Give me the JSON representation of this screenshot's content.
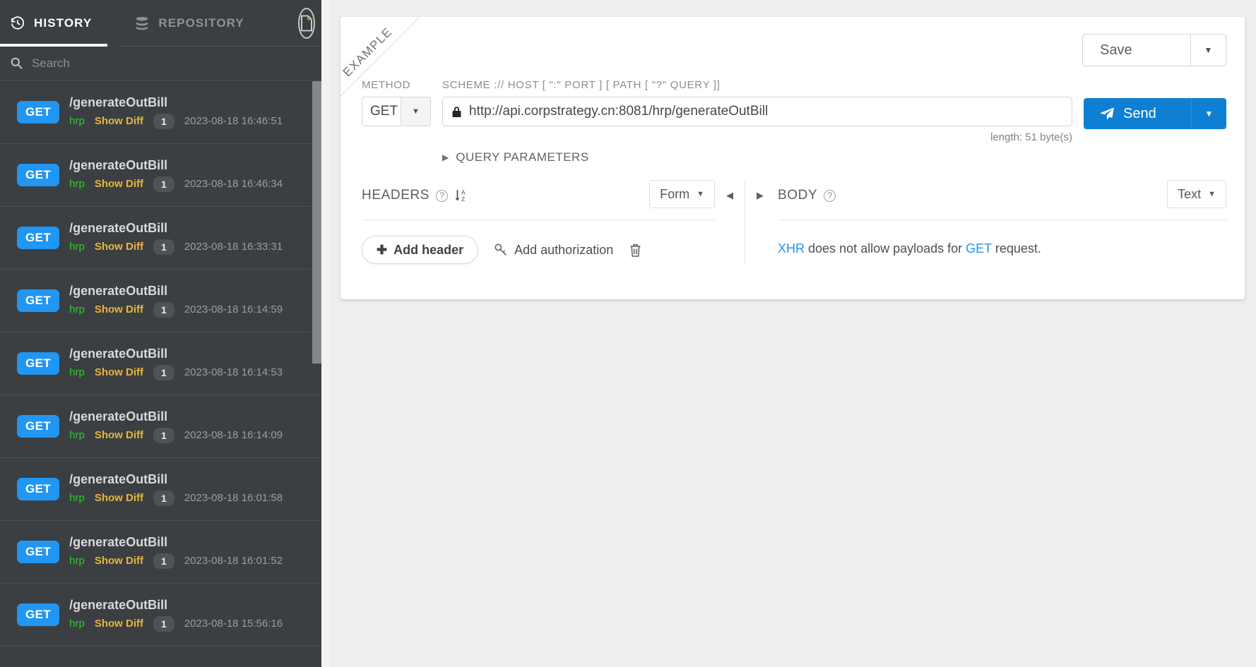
{
  "sidebar": {
    "tabs": [
      {
        "label": "HISTORY",
        "icon": "history-clock-icon",
        "active": true
      },
      {
        "label": "REPOSITORY",
        "icon": "database-icon",
        "active": false
      }
    ],
    "doc_button_icon": "document-icon",
    "collapse_icon": "chevron-left-icon",
    "search": {
      "placeholder": "Search",
      "value": "",
      "icon": "search-icon"
    },
    "history": [
      {
        "method": "GET",
        "path": "/generateOutBill",
        "env": "hrp",
        "diff_label": "Show Diff",
        "count": "1",
        "time": "2023-08-18 16:46:51"
      },
      {
        "method": "GET",
        "path": "/generateOutBill",
        "env": "hrp",
        "diff_label": "Show Diff",
        "count": "1",
        "time": "2023-08-18 16:46:34"
      },
      {
        "method": "GET",
        "path": "/generateOutBill",
        "env": "hrp",
        "diff_label": "Show Diff",
        "count": "1",
        "time": "2023-08-18 16:33:31"
      },
      {
        "method": "GET",
        "path": "/generateOutBill",
        "env": "hrp",
        "diff_label": "Show Diff",
        "count": "1",
        "time": "2023-08-18 16:14:59"
      },
      {
        "method": "GET",
        "path": "/generateOutBill",
        "env": "hrp",
        "diff_label": "Show Diff",
        "count": "1",
        "time": "2023-08-18 16:14:53"
      },
      {
        "method": "GET",
        "path": "/generateOutBill",
        "env": "hrp",
        "diff_label": "Show Diff",
        "count": "1",
        "time": "2023-08-18 16:14:09"
      },
      {
        "method": "GET",
        "path": "/generateOutBill",
        "env": "hrp",
        "diff_label": "Show Diff",
        "count": "1",
        "time": "2023-08-18 16:01:58"
      },
      {
        "method": "GET",
        "path": "/generateOutBill",
        "env": "hrp",
        "diff_label": "Show Diff",
        "count": "1",
        "time": "2023-08-18 16:01:52"
      },
      {
        "method": "GET",
        "path": "/generateOutBill",
        "env": "hrp",
        "diff_label": "Show Diff",
        "count": "1",
        "time": "2023-08-18 15:56:16"
      }
    ]
  },
  "main": {
    "ribbon": "EXAMPLE",
    "save": {
      "label": "Save",
      "caret_icon": "caret-down-icon"
    },
    "method": {
      "label": "METHOD",
      "value": "GET",
      "caret_icon": "caret-down-icon"
    },
    "url": {
      "label": "SCHEME :// HOST [ \":\" PORT ] [ PATH [ \"?\" QUERY ]]",
      "value": "http://api.corpstrategy.cn:8081/hrp/generateOutBill",
      "placeholder": "",
      "lock_icon": "lock-icon",
      "length_note": "length: 51 byte(s)"
    },
    "query_parameters": {
      "label": "QUERY PARAMETERS",
      "toggle_icon": "triangle-right-icon"
    },
    "send": {
      "label": "Send",
      "icon": "paper-plane-icon",
      "caret_icon": "caret-down-icon"
    },
    "headers": {
      "title": "HEADERS",
      "help_icon": "question-circle-icon",
      "sort_icon": "sort-alpha-asc-icon",
      "view_mode": "Form",
      "add_header_label": "Add header",
      "add_authorization_label": "Add authorization",
      "auth_icon": "key-icon",
      "delete_icon": "trash-icon",
      "plus_icon": "plus-icon"
    },
    "body": {
      "title": "BODY",
      "help_icon": "question-circle-icon",
      "collapse_left_icon": "triangle-left-icon",
      "expand_right_icon": "triangle-right-icon",
      "format": "Text",
      "message_prefix": "XHR",
      "message_middle": " does not allow payloads for ",
      "message_method": "GET",
      "message_suffix": " request."
    }
  },
  "colors": {
    "accent_blue": "#0f7fd4",
    "badge_blue": "#2196f3",
    "env_green": "#2ecc2e",
    "diff_amber": "#e8b53c",
    "sidebar_bg": "#3b3f42",
    "page_bg": "#eeeeee"
  }
}
